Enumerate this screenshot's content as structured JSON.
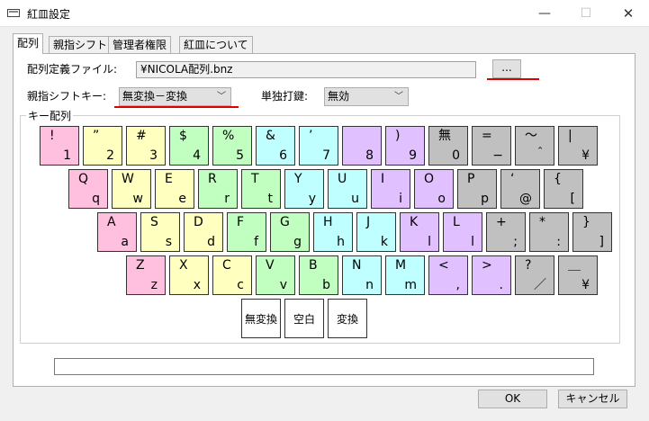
{
  "window": {
    "title": "紅皿設定",
    "min": "—",
    "max": "☐",
    "close": "✕",
    "icon": "app-window-icon"
  },
  "tabs": [
    {
      "label": "配列",
      "active": true
    },
    {
      "label": "親指シフト",
      "active": false
    },
    {
      "label": "管理者権限",
      "active": false
    },
    {
      "label": "紅皿について",
      "active": false
    }
  ],
  "layout_file": {
    "label": "配列定義ファイル:",
    "value": "¥NICOLA配列.bnz",
    "browse_label": "..."
  },
  "thumb_shift": {
    "label": "親指シフトキー:",
    "value": "無変換－変換"
  },
  "single_key": {
    "label": "単独打鍵:",
    "value": "無効"
  },
  "keys_group": {
    "title": "キー配列"
  },
  "keyboard": {
    "rows": [
      [
        {
          "u": "!",
          "l": "1",
          "color": "pink"
        },
        {
          "u": "”",
          "l": "2",
          "color": "yellow"
        },
        {
          "u": "#",
          "l": "3",
          "color": "yellow"
        },
        {
          "u": "$",
          "l": "4",
          "color": "green"
        },
        {
          "u": "%",
          "l": "5",
          "color": "green"
        },
        {
          "u": "&",
          "l": "6",
          "color": "cyan"
        },
        {
          "u": "’",
          "l": "7",
          "color": "cyan"
        },
        {
          "u": "",
          "l": "8",
          "color": "purple"
        },
        {
          "u": ")",
          "l": "9",
          "color": "purple"
        },
        {
          "u": "無",
          "l": "0",
          "color": "gray"
        },
        {
          "u": "=",
          "l": "−",
          "color": "gray"
        },
        {
          "u": "～",
          "l": "＾",
          "color": "gray"
        },
        {
          "u": "|",
          "l": "¥",
          "color": "gray"
        }
      ],
      [
        {
          "u": "Q",
          "l": "q",
          "color": "pink"
        },
        {
          "u": "W",
          "l": "w",
          "color": "yellow"
        },
        {
          "u": "E",
          "l": "e",
          "color": "yellow"
        },
        {
          "u": "R",
          "l": "r",
          "color": "green"
        },
        {
          "u": "T",
          "l": "t",
          "color": "green"
        },
        {
          "u": "Y",
          "l": "y",
          "color": "cyan"
        },
        {
          "u": "U",
          "l": "u",
          "color": "cyan"
        },
        {
          "u": "I",
          "l": "i",
          "color": "purple"
        },
        {
          "u": "O",
          "l": "o",
          "color": "purple"
        },
        {
          "u": "P",
          "l": "p",
          "color": "gray"
        },
        {
          "u": "‘",
          "l": "@",
          "color": "gray"
        },
        {
          "u": "{",
          "l": "[",
          "color": "gray"
        }
      ],
      [
        {
          "u": "A",
          "l": "a",
          "color": "pink"
        },
        {
          "u": "S",
          "l": "s",
          "color": "yellow"
        },
        {
          "u": "D",
          "l": "d",
          "color": "yellow"
        },
        {
          "u": "F",
          "l": "f",
          "color": "green"
        },
        {
          "u": "G",
          "l": "g",
          "color": "green"
        },
        {
          "u": "H",
          "l": "h",
          "color": "cyan"
        },
        {
          "u": "J",
          "l": "k",
          "color": "cyan"
        },
        {
          "u": "K",
          "l": "l",
          "color": "purple"
        },
        {
          "u": "L",
          "l": "l",
          "color": "purple"
        },
        {
          "u": "+",
          "l": ";",
          "color": "gray"
        },
        {
          "u": "*",
          "l": ":",
          "color": "gray"
        },
        {
          "u": "}",
          "l": "]",
          "color": "gray"
        }
      ],
      [
        {
          "u": "Z",
          "l": "z",
          "color": "pink"
        },
        {
          "u": "X",
          "l": "x",
          "color": "yellow"
        },
        {
          "u": "C",
          "l": "c",
          "color": "yellow"
        },
        {
          "u": "V",
          "l": "v",
          "color": "green"
        },
        {
          "u": "B",
          "l": "b",
          "color": "green"
        },
        {
          "u": "N",
          "l": "n",
          "color": "cyan"
        },
        {
          "u": "M",
          "l": "m",
          "color": "cyan"
        },
        {
          "u": "<",
          "l": ",",
          "color": "purple"
        },
        {
          "u": ">",
          "l": ".",
          "color": "purple"
        },
        {
          "u": "?",
          "l": "／",
          "color": "gray"
        },
        {
          "u": "＿",
          "l": "¥",
          "color": "gray"
        }
      ]
    ],
    "thumb_keys": [
      "無変換",
      "空白",
      "変換"
    ]
  },
  "footer": {
    "ok": "OK",
    "cancel": "キャンセル"
  },
  "colors": {
    "pink": "#ffc0e0",
    "yellow": "#ffffc0",
    "green": "#c0ffc0",
    "cyan": "#c0ffff",
    "purple": "#e0c0ff",
    "gray": "#c0c0c0",
    "annotation_red": "#e00000"
  }
}
